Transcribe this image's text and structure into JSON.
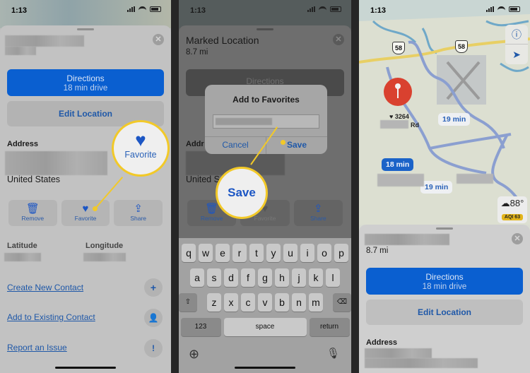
{
  "status_bar": {
    "time": "1:13"
  },
  "panel1": {
    "directions": {
      "label": "Directions",
      "sub": "18 min drive"
    },
    "edit_location": "Edit Location",
    "address_label": "Address",
    "country": "United States",
    "actions": [
      {
        "label": "Remove",
        "icon": "trash-icon"
      },
      {
        "label": "Favorite",
        "icon": "heart-icon"
      },
      {
        "label": "Share",
        "icon": "share-icon"
      }
    ],
    "latitude_label": "Latitude",
    "longitude_label": "Longitude",
    "links": [
      {
        "label": "Create New Contact",
        "icon": "plus-icon"
      },
      {
        "label": "Add to Existing Contact",
        "icon": "add-person-icon"
      },
      {
        "label": "Report an Issue",
        "icon": "report-icon"
      }
    ],
    "callout": "Favorite"
  },
  "panel2": {
    "title": "Marked Location",
    "distance": "8.7 mi",
    "directions": "Directions",
    "address_label": "Addr",
    "country": "United S",
    "actions": [
      "Remove",
      "Favorite",
      "Share"
    ],
    "dialog": {
      "title": "Add to Favorites",
      "cancel": "Cancel",
      "save": "Save"
    },
    "callout": "Save",
    "keyboard": {
      "row1": [
        "q",
        "w",
        "e",
        "r",
        "t",
        "y",
        "u",
        "i",
        "o",
        "p"
      ],
      "row2": [
        "a",
        "s",
        "d",
        "f",
        "g",
        "h",
        "j",
        "k",
        "l"
      ],
      "row3": [
        "z",
        "x",
        "c",
        "v",
        "b",
        "n",
        "m"
      ],
      "numbers": "123",
      "space": "space",
      "return": "return"
    }
  },
  "panel3": {
    "highway": "58",
    "favorite_label": "3264",
    "road_suffix": "Rd",
    "routes": [
      "19 min",
      "18 min",
      "19 min"
    ],
    "weather": {
      "temp": "88°",
      "aqi": "AQI 63"
    },
    "distance": "8.7 mi",
    "directions": {
      "label": "Directions",
      "sub": "18 min drive"
    },
    "edit_location": "Edit Location",
    "address_label": "Address"
  },
  "colors": {
    "accent": "#0a5fd0",
    "callout": "#f2c928",
    "pin": "#d9412f",
    "aqi": "#e3b51b"
  }
}
